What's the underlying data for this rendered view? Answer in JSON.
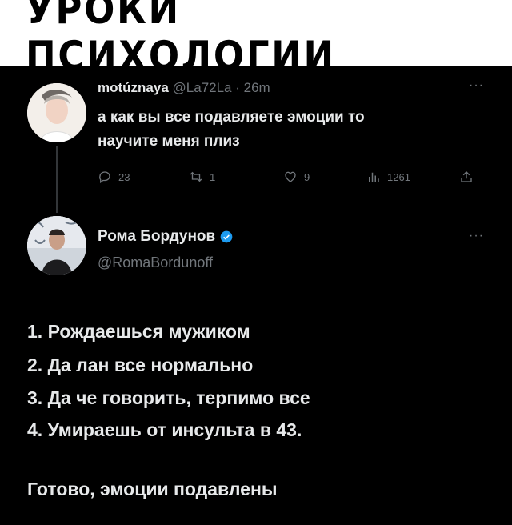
{
  "header": {
    "title": "УРОКИ ПСИХОЛОГИИ"
  },
  "tweet1": {
    "display_name": "motúznaya",
    "handle_time": "@La72La · 26m",
    "text_line1": "а как вы все подавляете эмоции то",
    "text_line2": "научите меня плиз",
    "replies": "23",
    "retweets": "1",
    "likes": "9",
    "views": "1261",
    "more": "···"
  },
  "tweet2": {
    "display_name": "Рома Бордунов",
    "handle": "@RomaBordunoff",
    "more": "···",
    "lines": [
      "1. Рождаешься мужиком",
      "2. Да лан все нормально",
      "3. Да че говорить, терпимо все",
      "4. Умираешь от инсульта в 43."
    ],
    "conclusion": "Готово, эмоции подавлены"
  },
  "colors": {
    "verified": "#1d9bf0",
    "muted": "#71767b",
    "text": "#e7e9ea"
  }
}
